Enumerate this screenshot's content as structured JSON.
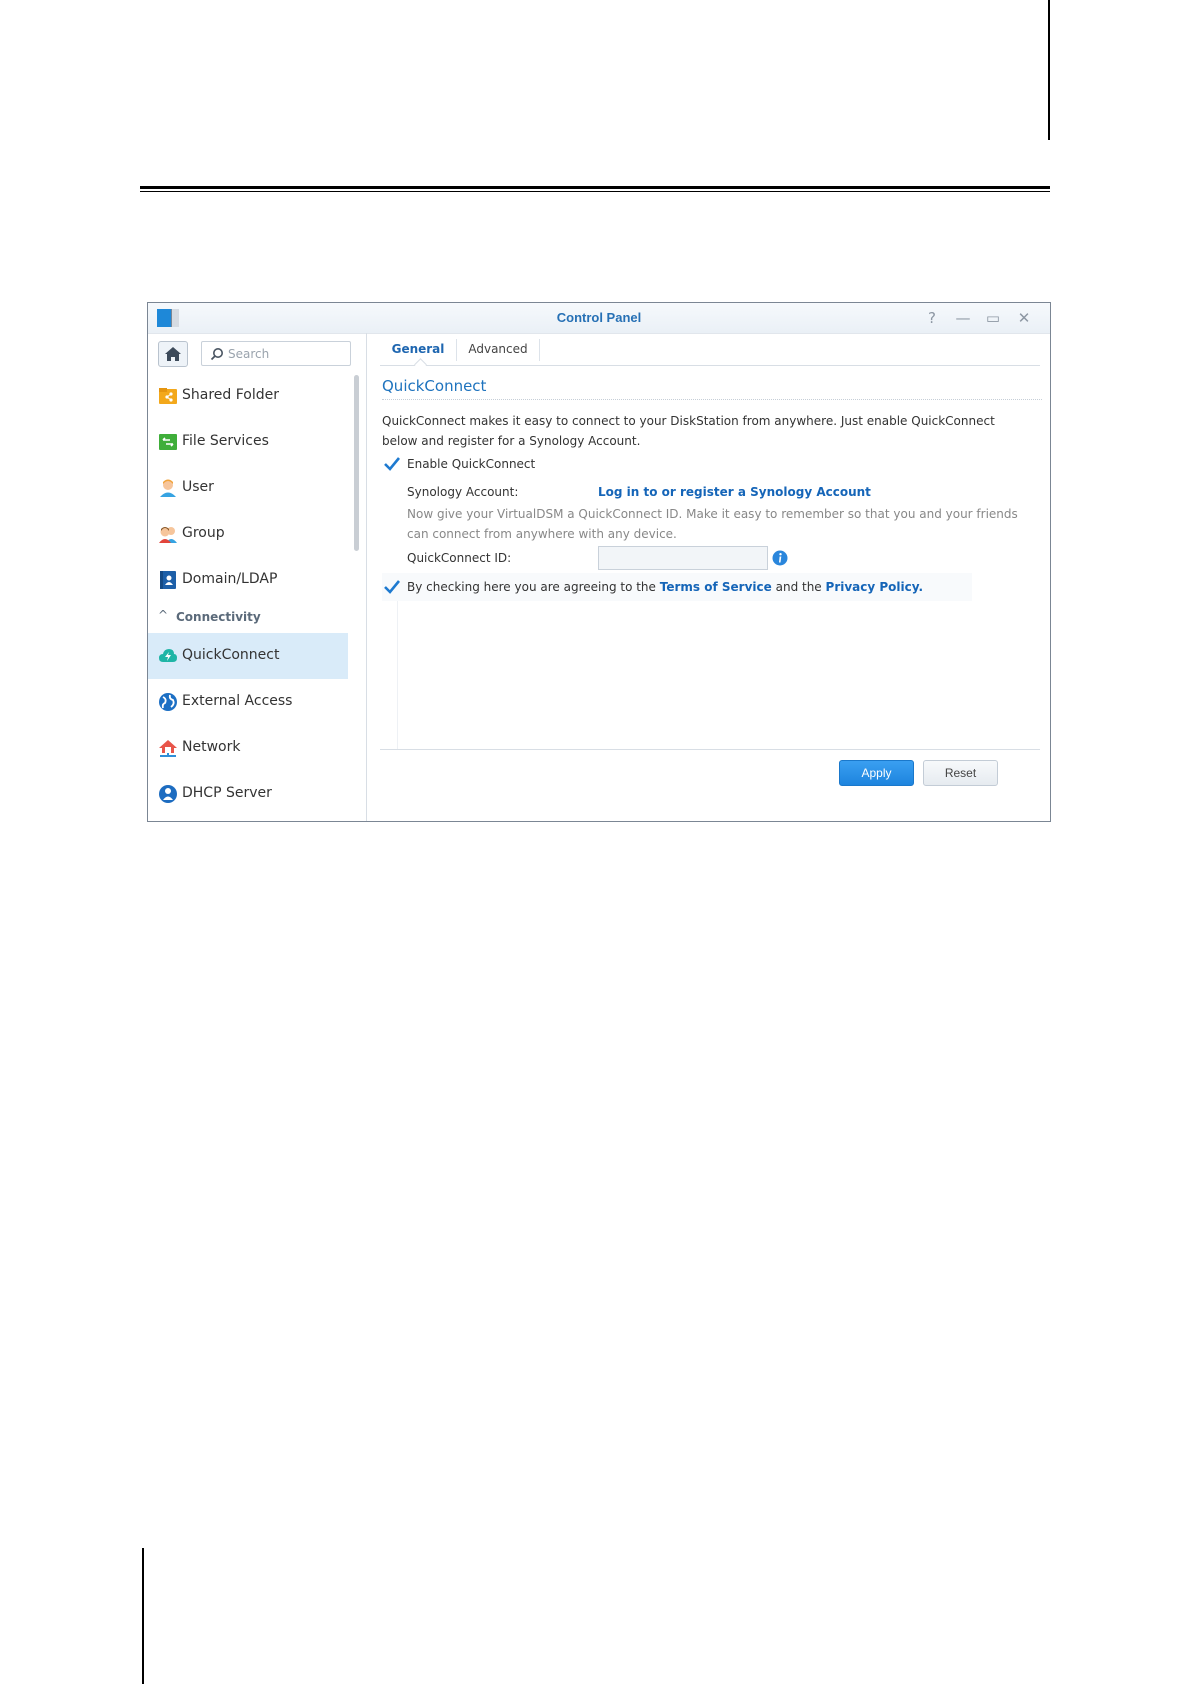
{
  "window": {
    "title": "Control Panel",
    "controls": {
      "help": "?",
      "minimize": "—",
      "maximize": "▭",
      "close": "✕"
    }
  },
  "sidebar": {
    "search_placeholder": "Search",
    "items": [
      {
        "label": "Shared Folder",
        "icon": "shared-folder-icon"
      },
      {
        "label": "File Services",
        "icon": "file-services-icon"
      },
      {
        "label": "User",
        "icon": "user-icon"
      },
      {
        "label": "Group",
        "icon": "group-icon"
      },
      {
        "label": "Domain/LDAP",
        "icon": "domain-ldap-icon"
      }
    ],
    "section": {
      "label": "Connectivity",
      "chevron": "^"
    },
    "section_items": [
      {
        "label": "QuickConnect",
        "icon": "quickconnect-icon",
        "active": true
      },
      {
        "label": "External Access",
        "icon": "external-access-icon"
      },
      {
        "label": "Network",
        "icon": "network-icon"
      },
      {
        "label": "DHCP Server",
        "icon": "dhcp-server-icon"
      }
    ]
  },
  "tabs": [
    {
      "label": "General",
      "active": true
    },
    {
      "label": "Advanced",
      "active": false
    }
  ],
  "content": {
    "section_title": "QuickConnect",
    "description": "QuickConnect makes it easy to connect to your DiskStation from anywhere. Just enable QuickConnect below and register for a Synology Account.",
    "enable_label": "Enable QuickConnect",
    "enable_checked": true,
    "account_label": "Synology Account:",
    "account_link": "Log in to or register a Synology Account",
    "id_hint": "Now give your VirtualDSM a QuickConnect ID. Make it easy to remember so that you and your friends can connect from anywhere with any device.",
    "id_label": "QuickConnect ID:",
    "id_value": "",
    "agree_checked": true,
    "agree_prefix": "By checking here you are agreeing to the",
    "terms_link": "Terms of Service",
    "agree_and": "and the",
    "privacy_link": "Privacy Policy",
    "agree_suffix": "."
  },
  "buttons": {
    "apply": "Apply",
    "reset": "Reset"
  },
  "colors": {
    "accent": "#1e73be",
    "active_bg": "#d9ebf9",
    "apply_bg": "#2a90e8"
  }
}
